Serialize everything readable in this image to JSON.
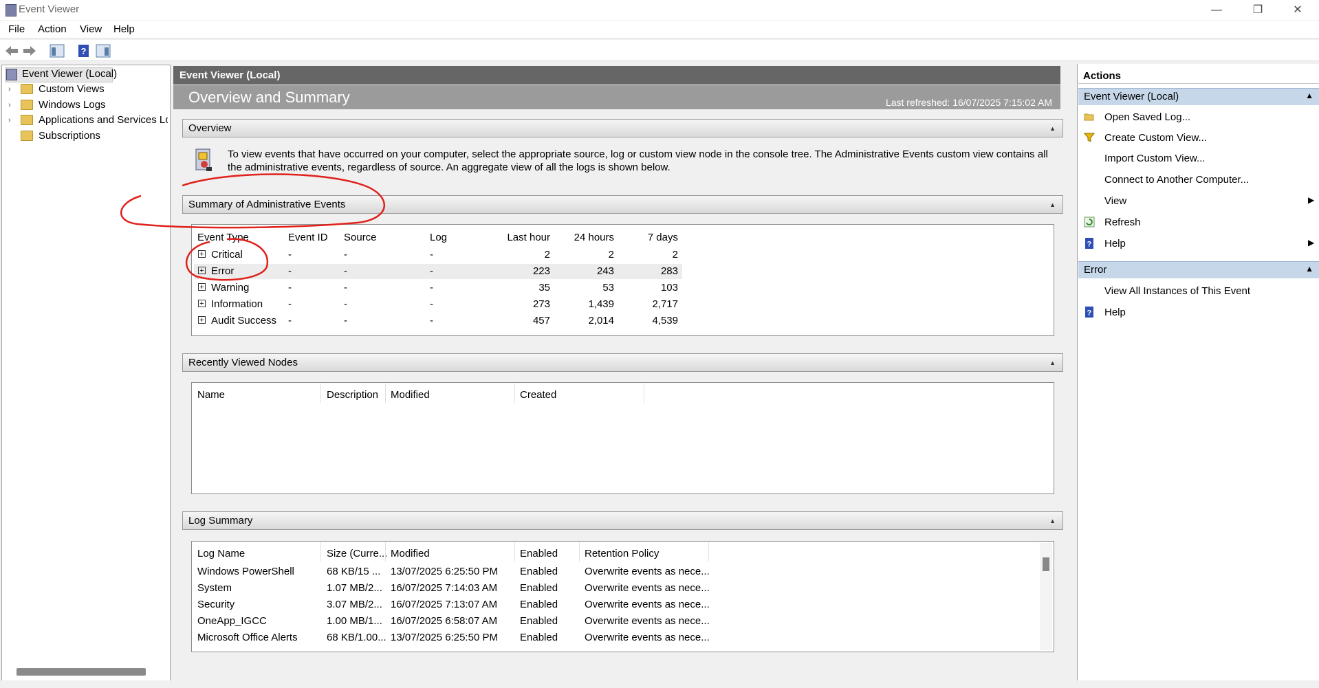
{
  "window": {
    "title": "Event Viewer"
  },
  "menu": {
    "items": [
      "File",
      "Action",
      "View",
      "Help"
    ]
  },
  "tree": {
    "root": "Event Viewer (Local)",
    "items": [
      "Custom Views",
      "Windows Logs",
      "Applications and Services Log",
      "Subscriptions"
    ]
  },
  "center": {
    "header": "Event Viewer (Local)",
    "overview_title": "Overview and Summary",
    "last_refreshed": "Last refreshed: 16/07/2025 7:15:02 AM",
    "overview_section": "Overview",
    "overview_text": "To view events that have occurred on your computer, select the appropriate source, log or custom view node in the console tree. The Administrative Events custom view contains all the administrative events, regardless of source. An aggregate view of all the logs is shown below.",
    "summary_section": "Summary of Administrative Events",
    "summary_columns": [
      "Event Type",
      "Event ID",
      "Source",
      "Log",
      "Last hour",
      "24 hours",
      "7 days"
    ],
    "summary_rows": [
      {
        "type": "Critical",
        "id": "-",
        "source": "-",
        "log": "-",
        "hour": "2",
        "day": "2",
        "week": "2"
      },
      {
        "type": "Error",
        "id": "-",
        "source": "-",
        "log": "-",
        "hour": "223",
        "day": "243",
        "week": "283"
      },
      {
        "type": "Warning",
        "id": "-",
        "source": "-",
        "log": "-",
        "hour": "35",
        "day": "53",
        "week": "103"
      },
      {
        "type": "Information",
        "id": "-",
        "source": "-",
        "log": "-",
        "hour": "273",
        "day": "1,439",
        "week": "2,717"
      },
      {
        "type": "Audit Success",
        "id": "-",
        "source": "-",
        "log": "-",
        "hour": "457",
        "day": "2,014",
        "week": "4,539"
      }
    ],
    "recent_section": "Recently Viewed Nodes",
    "recent_columns": [
      "Name",
      "Description",
      "Modified",
      "Created"
    ],
    "log_section": "Log Summary",
    "log_columns": [
      "Log Name",
      "Size (Curre...",
      "Modified",
      "Enabled",
      "Retention Policy"
    ],
    "log_rows": [
      {
        "name": "Windows PowerShell",
        "size": "68 KB/15 ...",
        "modified": "13/07/2025 6:25:50 PM",
        "enabled": "Enabled",
        "retention": "Overwrite events as nece..."
      },
      {
        "name": "System",
        "size": "1.07 MB/2...",
        "modified": "16/07/2025 7:14:03 AM",
        "enabled": "Enabled",
        "retention": "Overwrite events as nece..."
      },
      {
        "name": "Security",
        "size": "3.07 MB/2...",
        "modified": "16/07/2025 7:13:07 AM",
        "enabled": "Enabled",
        "retention": "Overwrite events as nece..."
      },
      {
        "name": "OneApp_IGCC",
        "size": "1.00 MB/1...",
        "modified": "16/07/2025 6:58:07 AM",
        "enabled": "Enabled",
        "retention": "Overwrite events as nece..."
      },
      {
        "name": "Microsoft Office Alerts",
        "size": "68 KB/1.00...",
        "modified": "13/07/2025 6:25:50 PM",
        "enabled": "Enabled",
        "retention": "Overwrite events as nece..."
      }
    ]
  },
  "actions": {
    "title": "Actions",
    "group1": "Event Viewer (Local)",
    "group1_items": [
      "Open Saved Log...",
      "Create Custom View...",
      "Import Custom View...",
      "Connect to Another Computer...",
      "View",
      "Refresh",
      "Help"
    ],
    "group2": "Error",
    "group2_items": [
      "View All Instances of This Event",
      "Help"
    ]
  },
  "colors": {
    "accent": "#c6d7ea",
    "annotation": "#e0201b"
  }
}
